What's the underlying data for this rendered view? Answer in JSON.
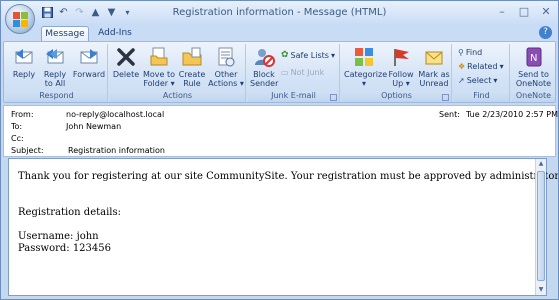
{
  "window": {
    "title": "Registration information - Message (HTML)"
  },
  "tabs": [
    {
      "label": "Message",
      "active": true
    },
    {
      "label": "Add-Ins",
      "active": false
    }
  ],
  "ribbon": {
    "respond": {
      "label": "Respond",
      "reply": "Reply",
      "reply_all_1": "Reply",
      "reply_all_2": "to All",
      "forward": "Forward"
    },
    "actions": {
      "label": "Actions",
      "delete": "Delete",
      "move_1": "Move to",
      "move_2": "Folder",
      "rule_1": "Create",
      "rule_2": "Rule",
      "other_1": "Other",
      "other_2": "Actions"
    },
    "junk": {
      "label": "Junk E-mail",
      "block_1": "Block",
      "block_2": "Sender",
      "safe": "Safe Lists",
      "not_junk": "Not Junk"
    },
    "options": {
      "label": "Options",
      "categorize": "Categorize",
      "follow_1": "Follow",
      "follow_2": "Up",
      "mark_1": "Mark as",
      "mark_2": "Unread"
    },
    "find": {
      "label": "Find",
      "find": "Find",
      "related": "Related",
      "select": "Select"
    },
    "onenote": {
      "label": "OneNote",
      "send_1": "Send to",
      "send_2": "OneNote"
    }
  },
  "header": {
    "from_label": "From:",
    "from": "no-reply@localhost.local",
    "to_label": "To:",
    "to": "John Newman",
    "cc_label": "Cc:",
    "cc": "",
    "subject_label": "Subject:",
    "subject": "Registration information",
    "sent_label": "Sent:",
    "sent": "Tue 2/23/2010 2:57 PM"
  },
  "body": {
    "line1": "Thank you for registering at our site CommunitySite. Your registration must be approved by administrator.",
    "line2": "Registration details:",
    "line3": "Username: john",
    "line4": "Password: 123456"
  }
}
